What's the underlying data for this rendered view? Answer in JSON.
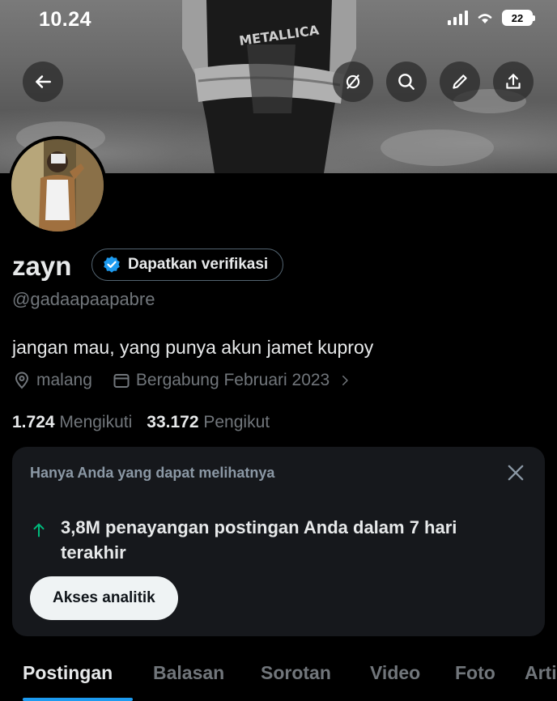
{
  "status_bar": {
    "time": "10.24",
    "battery": "22"
  },
  "header": {
    "back_icon": "arrow-left-icon",
    "action_icons": [
      "hide-icon",
      "search-icon",
      "edit-icon",
      "share-icon"
    ]
  },
  "profile": {
    "name": "zayn",
    "verify_label": "Dapatkan verifikasi",
    "handle": "@gadaapaapabre",
    "bio": "jangan mau, yang punya akun jamet kuproy",
    "location": "malang",
    "joined": "Bergabung Februari 2023",
    "following_count": "1.724",
    "following_label": "Mengikuti",
    "followers_count": "33.172",
    "followers_label": "Pengikut"
  },
  "analytics_card": {
    "caption": "Hanya Anda yang dapat melihatnya",
    "stat_text": "3,8M penayangan postingan Anda dalam 7 hari terakhir",
    "button_label": "Akses analitik"
  },
  "tabs": [
    "Postingan",
    "Balasan",
    "Sorotan",
    "Video",
    "Foto",
    "Artikel"
  ],
  "active_tab": "Postingan",
  "colors": {
    "background": "#000000",
    "text_primary": "#e7e9ea",
    "text_secondary": "#71767b",
    "accent": "#1d9bf0",
    "card_bg": "#16181c",
    "stat_arrow": "#00ba7c"
  }
}
